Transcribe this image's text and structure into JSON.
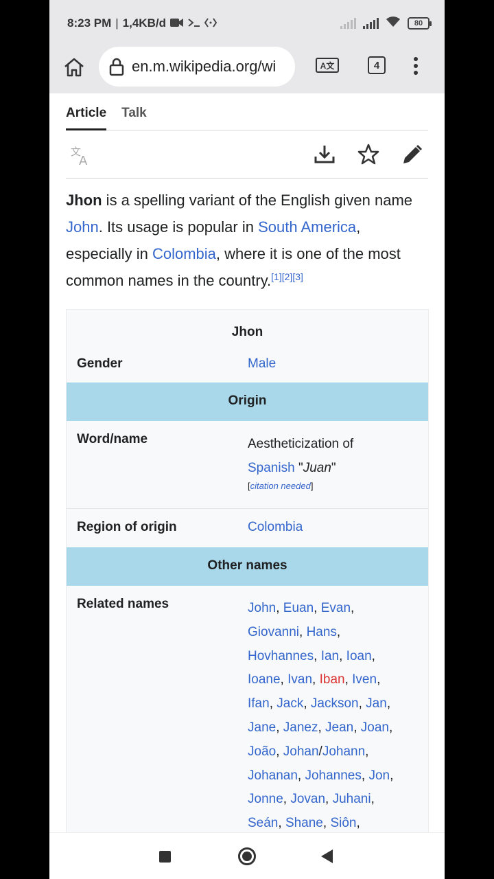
{
  "status_bar": {
    "time": "8:23 PM",
    "separator": "|",
    "network_speed": "1,4KB/d",
    "battery": "80"
  },
  "browser": {
    "url": "en.m.wikipedia.org/wi",
    "translate_label": "A文",
    "tab_count": "4"
  },
  "article_tabs": [
    {
      "label": "Article",
      "active": true
    },
    {
      "label": "Talk",
      "active": false
    }
  ],
  "intro": {
    "bold_name": "Jhon",
    "t1": " is a spelling variant of the English given name ",
    "link_john": "John",
    "t2": ". Its usage is popular in ",
    "link_south_america": "South America",
    "t3": ", especially in ",
    "link_colombia": "Colombia",
    "t4": ", where it is one of the most common names in the country.",
    "refs": [
      "[1]",
      "[2]",
      "[3]"
    ]
  },
  "infobox": {
    "title": "Jhon",
    "gender_label": "Gender",
    "gender_value": "Male",
    "origin_header": "Origin",
    "word_label": "Word/name",
    "word_text": "Aestheticization of",
    "word_link": "Spanish",
    "word_quote_open": " \"",
    "word_juan": "Juan",
    "word_quote_close": "\"",
    "cite_open": "[",
    "cite_text": "citation needed",
    "cite_close": "]",
    "region_label": "Region of origin",
    "region_value": "Colombia",
    "other_header": "Other names",
    "related_label": "Related names",
    "related_lines": [
      [
        {
          "t": "John",
          "l": true
        },
        {
          "t": ", "
        },
        {
          "t": "Euan",
          "l": true
        },
        {
          "t": ", "
        },
        {
          "t": "Evan",
          "l": true
        },
        {
          "t": ","
        }
      ],
      [
        {
          "t": "Giovanni",
          "l": true
        },
        {
          "t": ", "
        },
        {
          "t": "Hans",
          "l": true
        },
        {
          "t": ","
        }
      ],
      [
        {
          "t": "Hovhannes",
          "l": true
        },
        {
          "t": ", "
        },
        {
          "t": "Ian",
          "l": true
        },
        {
          "t": ", "
        },
        {
          "t": "Ioan",
          "l": true
        },
        {
          "t": ","
        }
      ],
      [
        {
          "t": "Ioane",
          "l": true
        },
        {
          "t": ", "
        },
        {
          "t": "Ivan",
          "l": true
        },
        {
          "t": ", "
        },
        {
          "t": "Iban",
          "r": true
        },
        {
          "t": ", "
        },
        {
          "t": "Iven",
          "l": true
        },
        {
          "t": ","
        }
      ],
      [
        {
          "t": "Ifan",
          "l": true
        },
        {
          "t": ", "
        },
        {
          "t": "Jack",
          "l": true
        },
        {
          "t": ", "
        },
        {
          "t": "Jackson",
          "l": true
        },
        {
          "t": ", "
        },
        {
          "t": "Jan",
          "l": true
        },
        {
          "t": ","
        }
      ],
      [
        {
          "t": "Jane",
          "l": true
        },
        {
          "t": ", "
        },
        {
          "t": "Janez",
          "l": true
        },
        {
          "t": ", "
        },
        {
          "t": "Jean",
          "l": true
        },
        {
          "t": ", "
        },
        {
          "t": "Joan",
          "l": true
        },
        {
          "t": ","
        }
      ],
      [
        {
          "t": "João",
          "l": true
        },
        {
          "t": ", "
        },
        {
          "t": "Johan",
          "l": true
        },
        {
          "t": "/"
        },
        {
          "t": "Johann",
          "l": true
        },
        {
          "t": ","
        }
      ],
      [
        {
          "t": "Johanan",
          "l": true
        },
        {
          "t": ", "
        },
        {
          "t": "Johannes",
          "l": true
        },
        {
          "t": ", "
        },
        {
          "t": "Jon",
          "l": true
        },
        {
          "t": ","
        }
      ],
      [
        {
          "t": "Jonne",
          "l": true
        },
        {
          "t": ", "
        },
        {
          "t": "Jovan",
          "l": true
        },
        {
          "t": ", "
        },
        {
          "t": "Juhani",
          "l": true
        },
        {
          "t": ","
        }
      ],
      [
        {
          "t": "Seán",
          "l": true
        },
        {
          "t": ", "
        },
        {
          "t": "Shane",
          "l": true
        },
        {
          "t": ", "
        },
        {
          "t": "Siôn",
          "l": true
        },
        {
          "t": ","
        }
      ]
    ]
  },
  "colors": {
    "link": "#3366cc",
    "redlink": "#dd3333",
    "infobox_header": "#a8d8ea",
    "chrome_bg": "#e8e8ea"
  }
}
